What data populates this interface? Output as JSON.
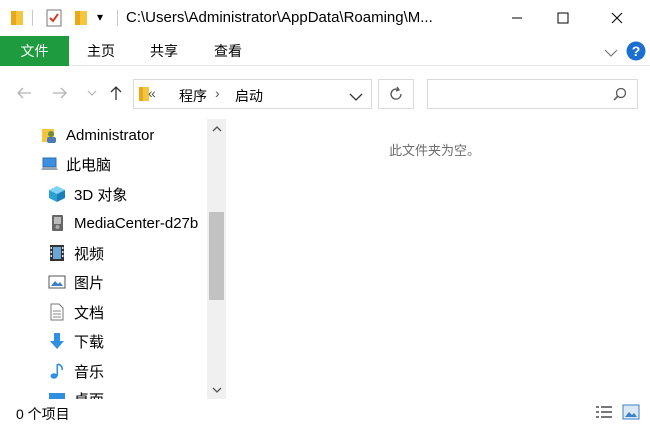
{
  "window": {
    "title": "C:\\Users\\Administrator\\AppData\\Roaming\\M...",
    "qat_dropdown": "▾"
  },
  "ribbon": {
    "file_tab": "文件",
    "tabs": [
      "主页",
      "共享",
      "查看"
    ]
  },
  "address": {
    "overflow": "«",
    "crumbs": [
      "程序",
      "启动"
    ],
    "separator": "›"
  },
  "nav_tree": [
    {
      "label": "Administrator",
      "icon": "user-folder-icon"
    },
    {
      "label": "此电脑",
      "icon": "computer-icon"
    },
    {
      "label": "3D 对象",
      "icon": "3d-objects-icon"
    },
    {
      "label": "MediaCenter-d27b",
      "icon": "media-device-icon"
    },
    {
      "label": "视频",
      "icon": "video-icon"
    },
    {
      "label": "图片",
      "icon": "pictures-icon"
    },
    {
      "label": "文档",
      "icon": "documents-icon"
    },
    {
      "label": "下载",
      "icon": "downloads-icon"
    },
    {
      "label": "音乐",
      "icon": "music-icon"
    },
    {
      "label": "桌面",
      "icon": "desktop-icon"
    }
  ],
  "content": {
    "empty_message": "此文件夹为空。"
  },
  "status": {
    "item_count": "0 个项目"
  },
  "colors": {
    "file_tab": "#1e9b3e",
    "help": "#1a6fd1"
  }
}
